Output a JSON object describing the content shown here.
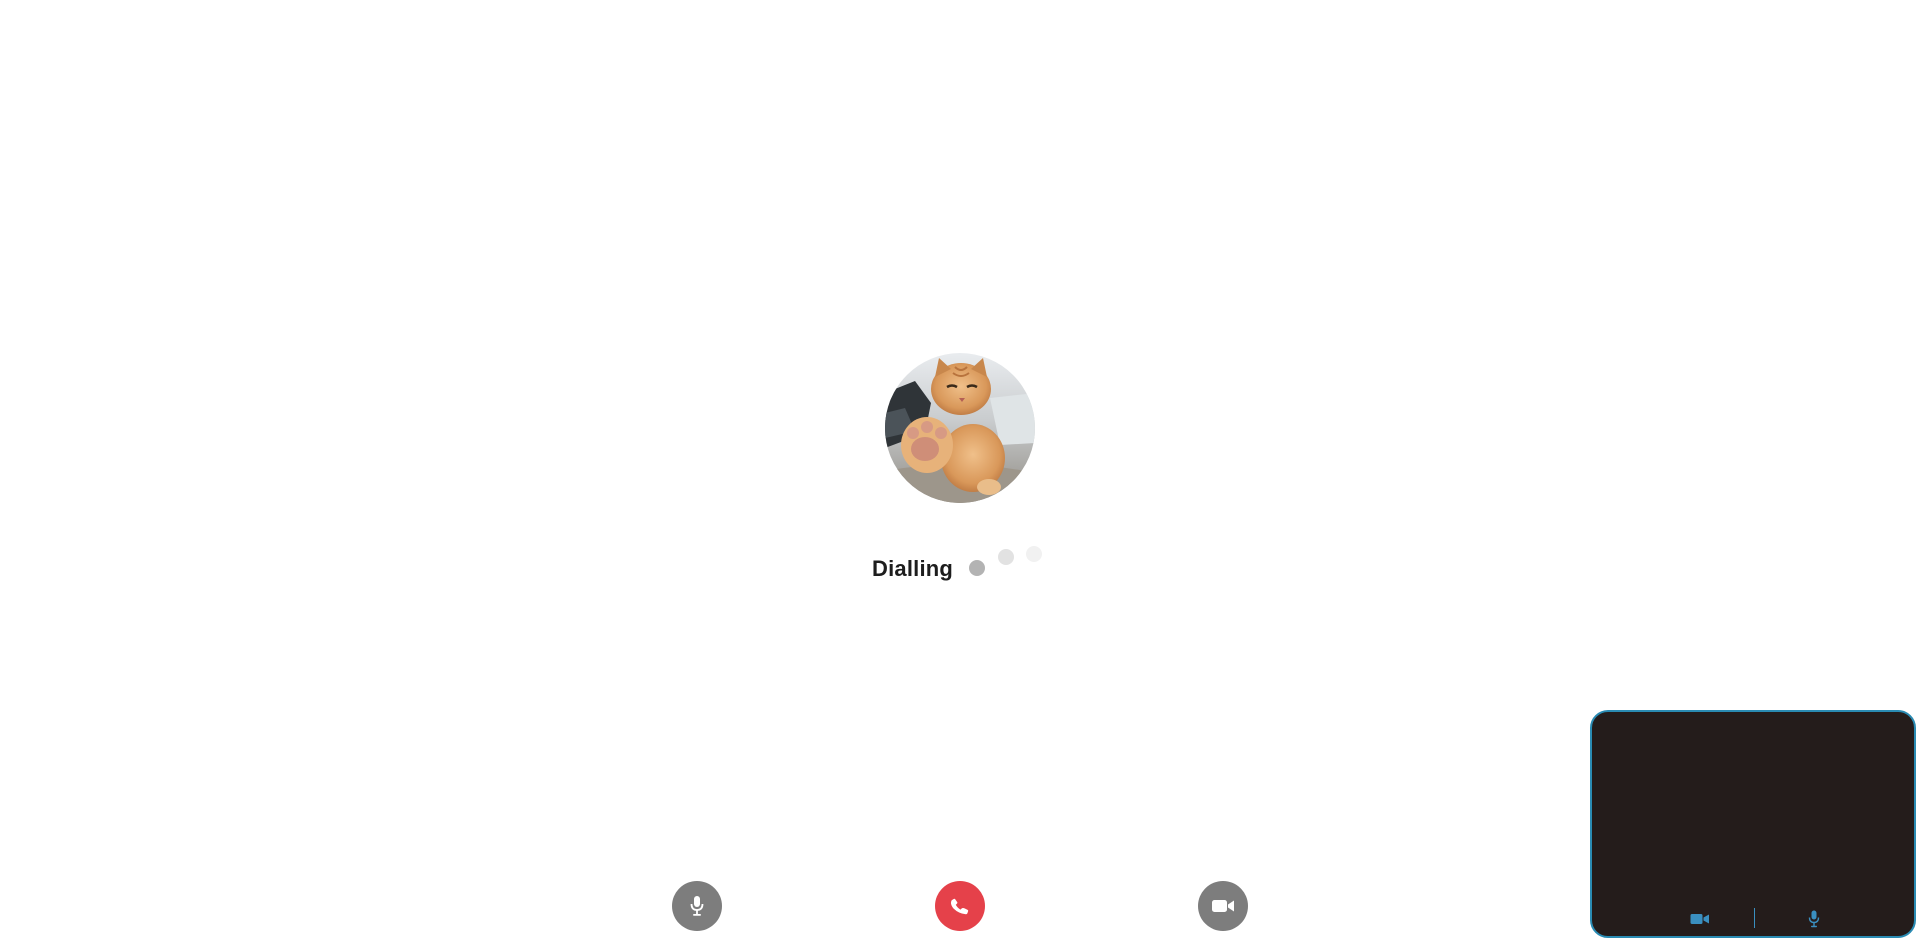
{
  "call": {
    "status_label": "Dialling",
    "avatar": "cat-photo-avatar"
  },
  "controls": {
    "mic": {
      "icon": "microphone-icon"
    },
    "hangup": {
      "icon": "phone-icon"
    },
    "video": {
      "icon": "video-camera-icon"
    }
  },
  "self_preview": {
    "camera_icon": "video-camera-icon",
    "mic_icon": "microphone-icon"
  },
  "colors": {
    "background": "#ffffff",
    "status_text": "#1d1d1d",
    "dot_1": "#b3b3b3",
    "dot_2": "#e2e2e2",
    "dot_3": "#f1f1f1",
    "control_gray": "#7d7d7d",
    "hangup_red": "#e5414a",
    "icon_white": "#ffffff",
    "preview_background": "#241c1b",
    "preview_border": "#2a8bb3",
    "preview_icons": "#3a8fc0"
  }
}
